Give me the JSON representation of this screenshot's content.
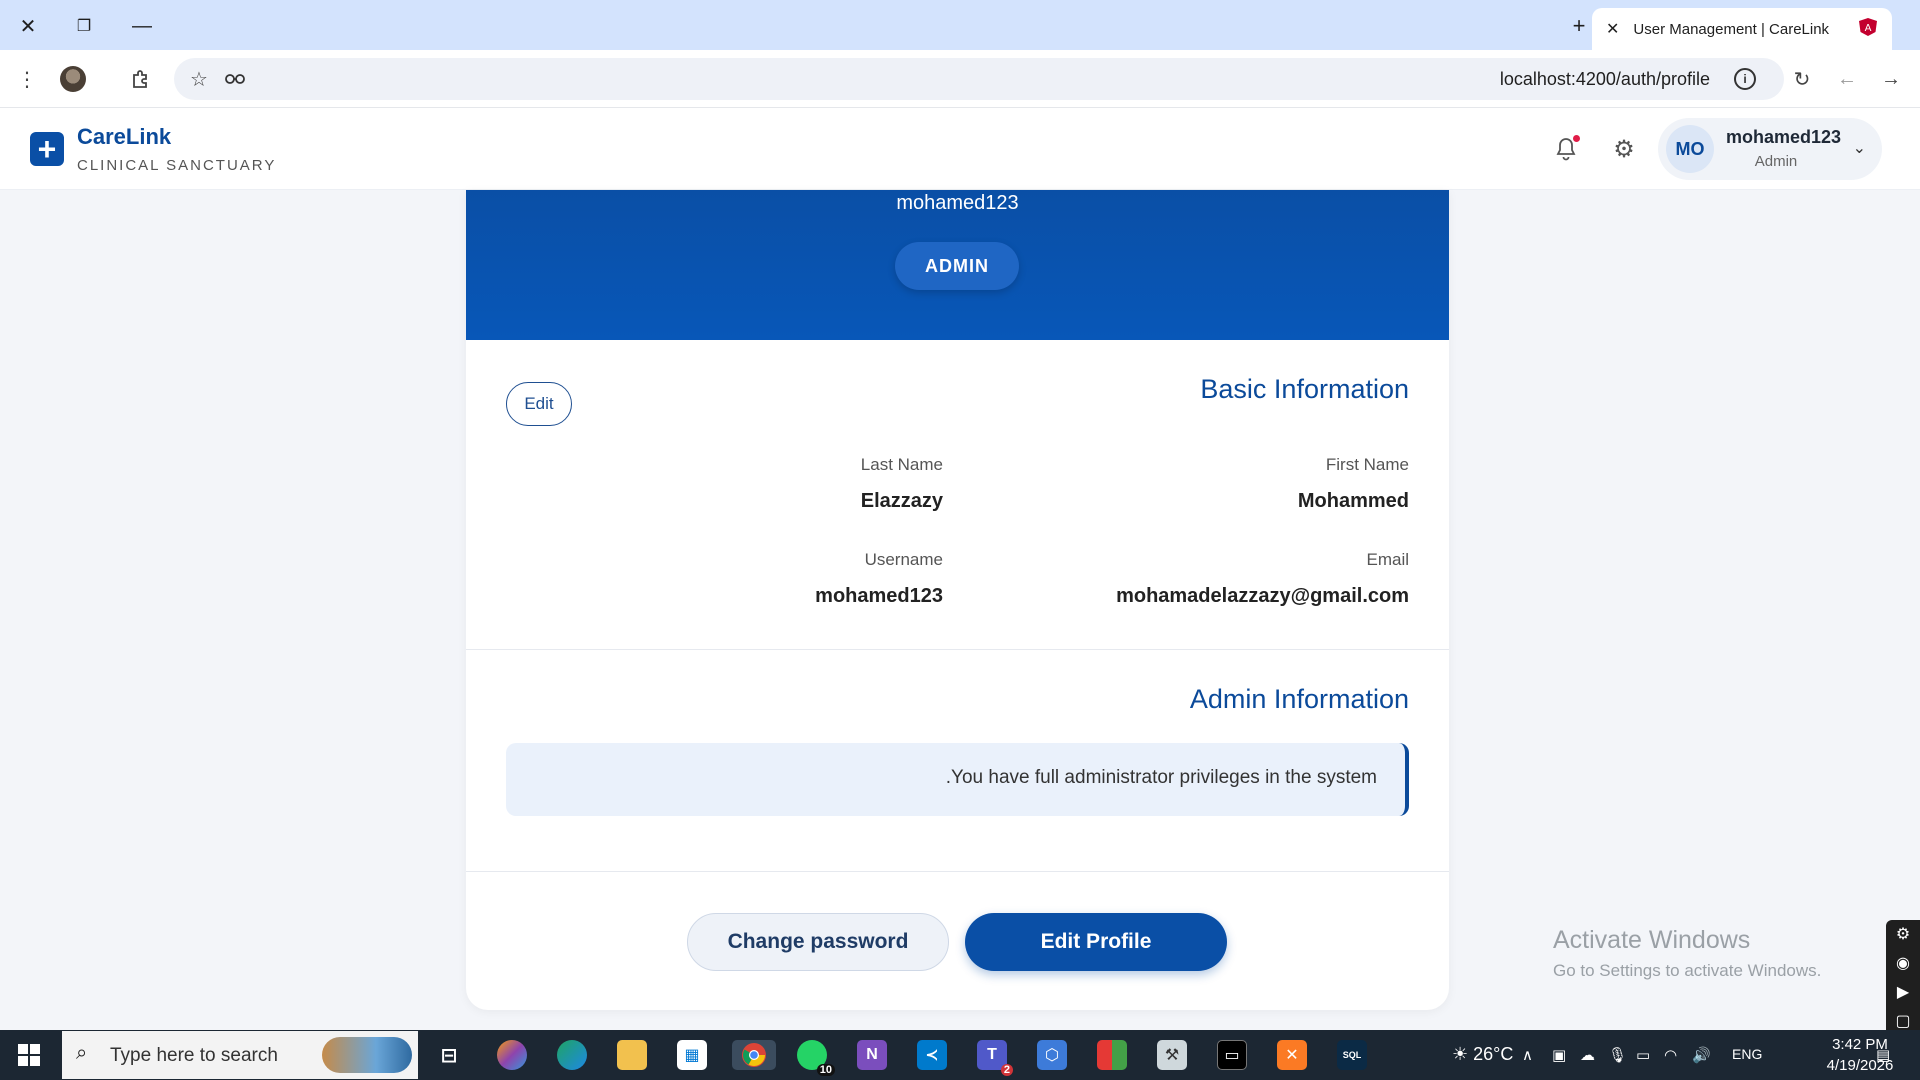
{
  "browser": {
    "tab_title": "User Management | CareLink",
    "url": "localhost:4200/auth/profile"
  },
  "header": {
    "brand": "CareLink",
    "brand_sub": "CLINICAL SANCTUARY",
    "user_initials": "MO",
    "user_name": "mohamed123",
    "user_role": "Admin"
  },
  "banner": {
    "username": "mohamed123",
    "role_badge": "ADMIN"
  },
  "basic_info": {
    "title": "Basic Information",
    "edit_label": "Edit",
    "fields": [
      {
        "label": "First Name",
        "value": "Mohammed"
      },
      {
        "label": "Last Name",
        "value": "Elazzazy"
      },
      {
        "label": "Email",
        "value": "mohamadelazzazy@gmail.com"
      },
      {
        "label": "Username",
        "value": "mohamed123"
      }
    ]
  },
  "admin_info": {
    "title": "Admin Information",
    "message": ".You have full administrator privileges in the system"
  },
  "actions": {
    "change_password": "Change password",
    "edit_profile": "Edit Profile"
  },
  "watermark": {
    "line1": "Activate Windows",
    "line2": "Go to Settings to activate Windows."
  },
  "taskbar": {
    "search_placeholder": "Type here to search",
    "whatsapp_badge": "10",
    "teams_badge": "2",
    "weather": "26°C",
    "lang": "ENG",
    "time": "3:42 PM",
    "date": "4/19/2026"
  }
}
